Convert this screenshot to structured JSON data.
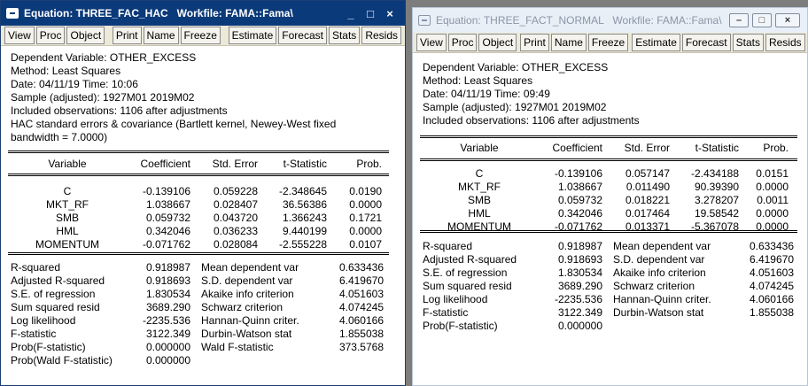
{
  "win1": {
    "title": "Equation: THREE_FAC_HAC   Workfile: FAMA::Fama\\",
    "controls": {
      "minimize": "_",
      "maximize": "□",
      "close": "×"
    },
    "toolbar": [
      "View",
      "Proc",
      "Object",
      "Print",
      "Name",
      "Freeze",
      "Estimate",
      "Forecast",
      "Stats",
      "Resids"
    ],
    "header": [
      "Dependent Variable: OTHER_EXCESS",
      "Method: Least Squares",
      "Date: 04/11/19   Time: 10:06",
      "Sample (adjusted): 1927M01 2019M02",
      "Included observations: 1106 after adjustments",
      "HAC standard errors & covariance (Bartlett kernel, Newey-West fixed",
      "     bandwidth = 7.0000)"
    ],
    "columns": [
      "Variable",
      "Coefficient",
      "Std. Error",
      "t-Statistic",
      "Prob."
    ],
    "rows": [
      [
        "C",
        "-0.139106",
        "0.059228",
        "-2.348645",
        "0.0190"
      ],
      [
        "MKT_RF",
        "1.038667",
        "0.028407",
        "36.56386",
        "0.0000"
      ],
      [
        "SMB",
        "0.059732",
        "0.043720",
        "1.366243",
        "0.1721"
      ],
      [
        "HML",
        "0.342046",
        "0.036233",
        "9.440199",
        "0.0000"
      ],
      [
        "MOMENTUM",
        "-0.071762",
        "0.028084",
        "-2.555228",
        "0.0107"
      ]
    ],
    "stats": [
      [
        "R-squared",
        "0.918987",
        "Mean dependent var",
        "0.633436"
      ],
      [
        "Adjusted R-squared",
        "0.918693",
        "S.D. dependent var",
        "6.419670"
      ],
      [
        "S.E. of regression",
        "1.830534",
        "Akaike info criterion",
        "4.051603"
      ],
      [
        "Sum squared resid",
        "3689.290",
        "Schwarz criterion",
        "4.074245"
      ],
      [
        "Log likelihood",
        "-2235.536",
        "Hannan-Quinn criter.",
        "4.060166"
      ],
      [
        "F-statistic",
        "3122.349",
        "Durbin-Watson stat",
        "1.855038"
      ],
      [
        "Prob(F-statistic)",
        "0.000000",
        "Wald F-statistic",
        "373.5768"
      ],
      [
        "Prob(Wald F-statistic)",
        "0.000000",
        "",
        ""
      ]
    ]
  },
  "win2": {
    "title": "Equation: THREE_FACT_NORMAL   Workfile: FAMA::Fama\\",
    "controls": {
      "minimize": "–",
      "maximize": "□",
      "close": "×"
    },
    "toolbar": [
      "View",
      "Proc",
      "Object",
      "Print",
      "Name",
      "Freeze",
      "Estimate",
      "Forecast",
      "Stats",
      "Resids"
    ],
    "header": [
      "Dependent Variable: OTHER_EXCESS",
      "Method: Least Squares",
      "Date: 04/11/19   Time: 09:49",
      "Sample (adjusted): 1927M01 2019M02",
      "Included observations: 1106 after adjustments"
    ],
    "columns": [
      "Variable",
      "Coefficient",
      "Std. Error",
      "t-Statistic",
      "Prob."
    ],
    "rows": [
      [
        "C",
        "-0.139106",
        "0.057147",
        "-2.434188",
        "0.0151"
      ],
      [
        "MKT_RF",
        "1.038667",
        "0.011490",
        "90.39390",
        "0.0000"
      ],
      [
        "SMB",
        "0.059732",
        "0.018221",
        "3.278207",
        "0.0011"
      ],
      [
        "HML",
        "0.342046",
        "0.017464",
        "19.58542",
        "0.0000"
      ],
      [
        "MOMENTUM",
        "-0.071762",
        "0.013371",
        "-5.367078",
        "0.0000"
      ]
    ],
    "stats": [
      [
        "R-squared",
        "0.918987",
        "Mean dependent var",
        "0.633436"
      ],
      [
        "Adjusted R-squared",
        "0.918693",
        "S.D. dependent var",
        "6.419670"
      ],
      [
        "S.E. of regression",
        "1.830534",
        "Akaike info criterion",
        "4.051603"
      ],
      [
        "Sum squared resid",
        "3689.290",
        "Schwarz criterion",
        "4.074245"
      ],
      [
        "Log likelihood",
        "-2235.536",
        "Hannan-Quinn criter.",
        "4.060166"
      ],
      [
        "F-statistic",
        "3122.349",
        "Durbin-Watson stat",
        "1.855038"
      ],
      [
        "Prob(F-statistic)",
        "0.000000",
        "",
        ""
      ]
    ]
  }
}
